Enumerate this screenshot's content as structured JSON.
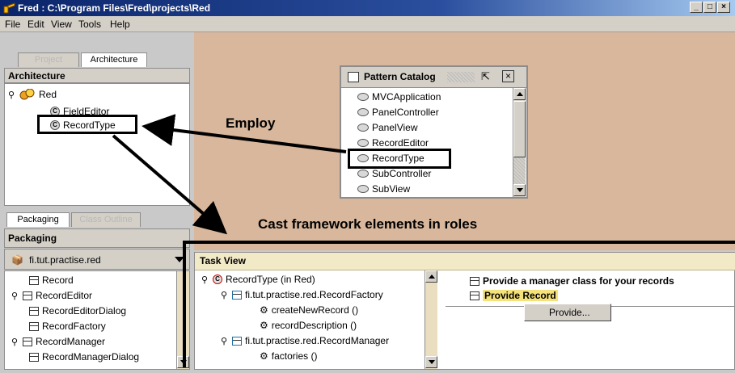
{
  "window": {
    "title": "Fred : C:\\Program Files\\Fred\\projects\\Red",
    "buttons": [
      "minimize",
      "maximize",
      "close"
    ]
  },
  "menu": [
    "File",
    "Edit",
    "View",
    "Tools",
    "Help"
  ],
  "architecture_panel": {
    "tabs": [
      {
        "label": "Project",
        "active": false
      },
      {
        "label": "Architecture",
        "active": true
      }
    ],
    "header": "Architecture",
    "tree": {
      "root": "Red",
      "children": [
        "FieldEditor",
        "RecordType"
      ]
    }
  },
  "packaging_panel": {
    "tabs": [
      {
        "label": "Packaging",
        "active": true
      },
      {
        "label": "Class Outline",
        "active": false
      }
    ],
    "header": "Packaging",
    "package": "fi.tut.practise.red",
    "items": [
      "Record",
      "RecordEditor",
      "RecordEditorDialog",
      "RecordFactory",
      "RecordManager",
      "RecordManagerDialog"
    ]
  },
  "pattern_catalog": {
    "title": "Pattern Catalog",
    "items": [
      "MVCApplication",
      "PanelController",
      "PanelView",
      "RecordEditor",
      "RecordType",
      "SubController",
      "SubView"
    ]
  },
  "task_view": {
    "header": "Task View",
    "tree": {
      "root": "RecordType (in Red)",
      "factory": "fi.tut.practise.red.RecordFactory",
      "factory_methods": [
        "createNewRecord ()",
        "recordDescription ()"
      ],
      "manager": "fi.tut.practise.red.RecordManager",
      "manager_methods": [
        "factories ()"
      ]
    },
    "tasks": [
      "Provide a manager class for your records",
      "Provide Record"
    ]
  },
  "context_menu": {
    "item": "Provide..."
  },
  "annotations": {
    "employ": "Employ",
    "cast": "Cast framework elements in roles"
  },
  "colors": {
    "title_bar": "#0a246a",
    "main_background": "#d8b79c",
    "task_header": "#f2eac7",
    "highlight": "#f5e27a"
  }
}
